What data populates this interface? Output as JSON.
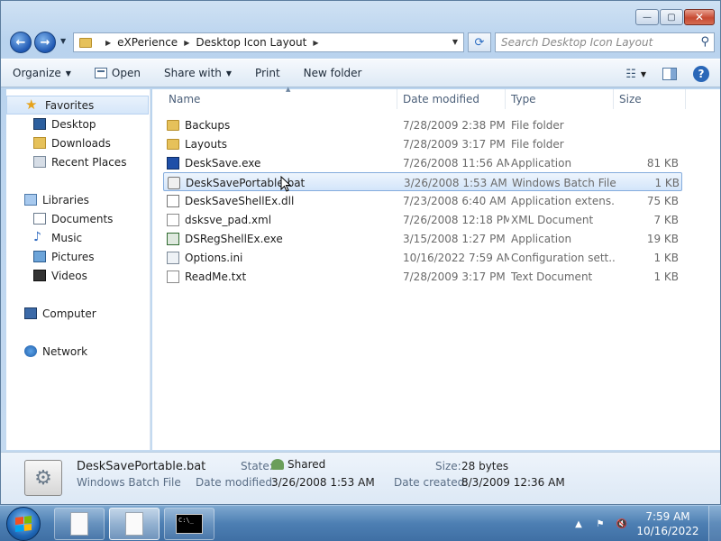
{
  "window": {
    "minimize_label": "—",
    "maximize_label": "▢",
    "close_label": "✕"
  },
  "address_bar": {
    "crumbs": [
      "eXPerience",
      "Desktop Icon Layout"
    ],
    "search_placeholder": "Search Desktop Icon Layout"
  },
  "toolbar": {
    "organize": "Organize",
    "open": "Open",
    "share_with": "Share with",
    "print": "Print",
    "new_folder": "New folder"
  },
  "sidebar": {
    "favorites": "Favorites",
    "desktop": "Desktop",
    "downloads": "Downloads",
    "recent_places": "Recent Places",
    "libraries": "Libraries",
    "documents": "Documents",
    "music": "Music",
    "pictures": "Pictures",
    "videos": "Videos",
    "computer": "Computer",
    "network": "Network"
  },
  "columns": {
    "name": "Name",
    "date_modified": "Date modified",
    "type": "Type",
    "size": "Size"
  },
  "files": [
    {
      "name": "Backups",
      "date": "7/28/2009 2:38 PM",
      "type": "File folder",
      "size": "",
      "icon": "folder-icon"
    },
    {
      "name": "Layouts",
      "date": "7/28/2009 3:17 PM",
      "type": "File folder",
      "size": "",
      "icon": "folder-icon"
    },
    {
      "name": "DeskSave.exe",
      "date": "7/26/2008 11:56 AM",
      "type": "Application",
      "size": "81 KB",
      "icon": "exe-icon"
    },
    {
      "name": "DeskSavePortable.bat",
      "date": "3/26/2008 1:53 AM",
      "type": "Windows Batch File",
      "size": "1 KB",
      "icon": "batch-file-icon",
      "selected": true
    },
    {
      "name": "DeskSaveShellEx.dll",
      "date": "7/23/2008 6:40 AM",
      "type": "Application extens...",
      "size": "75 KB",
      "icon": "dll-icon"
    },
    {
      "name": "dsksve_pad.xml",
      "date": "7/26/2008 12:18 PM",
      "type": "XML Document",
      "size": "7 KB",
      "icon": "xml-icon"
    },
    {
      "name": "DSRegShellEx.exe",
      "date": "3/15/2008 1:27 PM",
      "type": "Application",
      "size": "19 KB",
      "icon": "exe-icon"
    },
    {
      "name": "Options.ini",
      "date": "10/16/2022 7:59 AM",
      "type": "Configuration sett...",
      "size": "1 KB",
      "icon": "ini-icon"
    },
    {
      "name": "ReadMe.txt",
      "date": "7/28/2009 3:17 PM",
      "type": "Text Document",
      "size": "1 KB",
      "icon": "text-file-icon"
    }
  ],
  "details": {
    "filename": "DeskSavePortable.bat",
    "filetype": "Windows Batch File",
    "state_label": "State:",
    "state_value": "Shared",
    "size_label": "Size:",
    "size_value": "28 bytes",
    "modified_label": "Date modified:",
    "modified_value": "3/26/2008 1:53 AM",
    "created_label": "Date created:",
    "created_value": "8/3/2009 12:36 AM"
  },
  "taskbar": {
    "cmd_text": "C:\\_",
    "time": "7:59 AM",
    "date": "10/16/2022"
  }
}
